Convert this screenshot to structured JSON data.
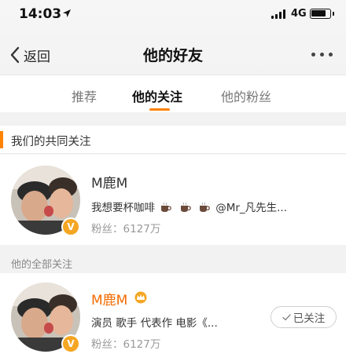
{
  "status_bar": {
    "time": "14:03",
    "network": "4G"
  },
  "nav": {
    "back_label": "返回",
    "title": "他的好友"
  },
  "tabs": [
    {
      "label": "推荐"
    },
    {
      "label": "他的关注"
    },
    {
      "label": "他的粉丝"
    }
  ],
  "active_tab": 1,
  "common_section": {
    "title": "我们的共同关注",
    "user": {
      "name": "M鹿M",
      "desc_text": "我想要杯咖啡",
      "desc_suffix": "@Mr_凡先生...",
      "fans_label": "粉丝：",
      "fans_count": "6127万"
    }
  },
  "all_section": {
    "title": "他的全部关注",
    "user": {
      "name": "M鹿M",
      "desc": "演员 歌手 代表作 电影《...",
      "fans_label": "粉丝：",
      "fans_count": "6127万",
      "follow_label": "已关注"
    }
  },
  "colors": {
    "accent": "#ff8200",
    "name_vip": "#f36b00",
    "badge": "#f5a623"
  },
  "icons": [
    "location-arrow-icon",
    "signal-icon",
    "battery-icon",
    "back-chevron-icon",
    "more-icon",
    "verified-badge-icon",
    "coffee-icon",
    "crown-icon",
    "check-icon"
  ]
}
